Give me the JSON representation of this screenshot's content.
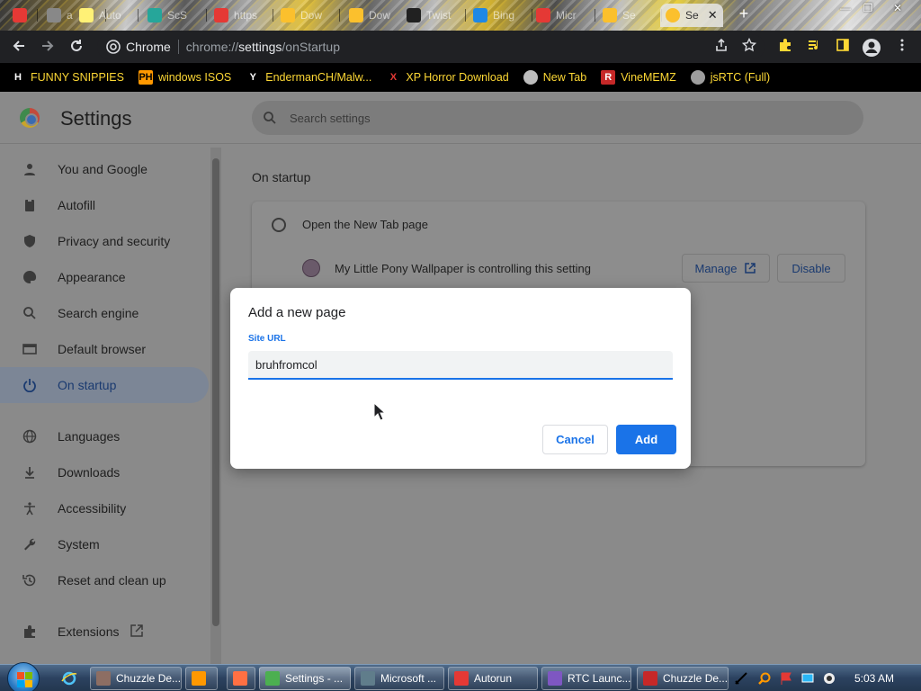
{
  "browser": {
    "tabs": [
      {
        "title": "",
        "color": "#e53935"
      },
      {
        "title": "a",
        "color": "#888888"
      },
      {
        "title": "Auto",
        "color": "#fff176"
      },
      {
        "title": "ScS",
        "color": "#26a69a"
      },
      {
        "title": "https",
        "color": "#e53935"
      },
      {
        "title": "Dow",
        "color": "#fbc02d"
      },
      {
        "title": "Dow",
        "color": "#fbc02d"
      },
      {
        "title": "Twist",
        "color": "#212121"
      },
      {
        "title": "Bing",
        "color": "#1e88e5"
      },
      {
        "title": "Micr",
        "color": "#e53935"
      },
      {
        "title": "Se",
        "color": "#fbc02d"
      },
      {
        "title": "Se",
        "color": "#9e9e9e"
      }
    ],
    "active_tab": {
      "title": "Se",
      "close": "✕"
    },
    "new_tab": "+",
    "omnibox": {
      "site_label": "Chrome",
      "url_prefix": "chrome://",
      "url_host": "settings",
      "url_path": "/onStartup"
    },
    "bookmarks": [
      {
        "label": "FUNNY SNIPPIES",
        "icon": "H",
        "icon_bg": "#000000",
        "icon_fg": "#ffffff"
      },
      {
        "label": "windows ISOS",
        "icon": "PH",
        "icon_bg": "#ff9800",
        "icon_fg": "#000000"
      },
      {
        "label": "EndermanCH/Malw...",
        "icon": "Y",
        "icon_bg": "#000000",
        "icon_fg": "#ffffff"
      },
      {
        "label": "XP Horror Download",
        "icon": "X",
        "icon_bg": "#000000",
        "icon_fg": "#e53935"
      },
      {
        "label": "New Tab",
        "icon": "",
        "icon_bg": "#bdbdbd",
        "icon_fg": "#000000"
      },
      {
        "label": "VineMEMZ",
        "icon": "R",
        "icon_bg": "#c62828",
        "icon_fg": "#ffffff"
      },
      {
        "label": "jsRTC (Full)",
        "icon": "",
        "icon_bg": "#9e9e9e",
        "icon_fg": "#000000"
      }
    ]
  },
  "settings": {
    "title": "Settings",
    "search_placeholder": "Search settings",
    "nav": [
      {
        "label": "You and Google",
        "icon": "person-icon"
      },
      {
        "label": "Autofill",
        "icon": "clipboard-icon"
      },
      {
        "label": "Privacy and security",
        "icon": "shield-icon"
      },
      {
        "label": "Appearance",
        "icon": "palette-icon"
      },
      {
        "label": "Search engine",
        "icon": "search-icon"
      },
      {
        "label": "Default browser",
        "icon": "browser-icon"
      },
      {
        "label": "On startup",
        "icon": "power-icon",
        "selected": true
      },
      {
        "label": "Languages",
        "icon": "globe-icon"
      },
      {
        "label": "Downloads",
        "icon": "download-icon"
      },
      {
        "label": "Accessibility",
        "icon": "accessibility-icon"
      },
      {
        "label": "System",
        "icon": "wrench-icon"
      },
      {
        "label": "Reset and clean up",
        "icon": "history-icon"
      },
      {
        "label": "Extensions",
        "icon": "puzzle-icon"
      }
    ],
    "section_title": "On startup",
    "option_new_tab": "Open the New Tab page",
    "extension_notice": "My Little Pony Wallpaper is controlling this setting",
    "manage_label": "Manage",
    "disable_label": "Disable"
  },
  "dialog": {
    "title": "Add a new page",
    "field_label": "Site URL",
    "field_value": "bruhfromcol",
    "cancel_label": "Cancel",
    "add_label": "Add"
  },
  "taskbar": {
    "buttons": [
      {
        "label": "Chuzzle De...",
        "color": "#8d6e63"
      },
      {
        "label": "",
        "color": "#ff9800"
      },
      {
        "label": "",
        "color": "#ff7043"
      },
      {
        "label": "Settings - ...",
        "color": "#4caf50",
        "active": true
      },
      {
        "label": "Microsoft ...",
        "color": "#607d8b"
      },
      {
        "label": "Autorun",
        "color": "#e53935"
      },
      {
        "label": "RTC Launc...",
        "color": "#7e57c2"
      },
      {
        "label": "Chuzzle De...",
        "color": "#c62828"
      }
    ],
    "clock": "5:03 AM"
  }
}
